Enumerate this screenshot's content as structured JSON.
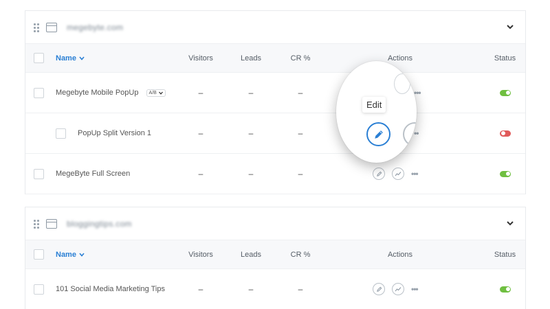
{
  "columns": {
    "name": "Name",
    "visitors": "Visitors",
    "leads": "Leads",
    "cr": "CR %",
    "actions": "Actions",
    "status": "Status"
  },
  "sites": [
    {
      "name": "megebyte.com",
      "rows": [
        {
          "name": "Megebyte Mobile PopUp",
          "badge": "A/B",
          "visitors": "–",
          "leads": "–",
          "cr": "–",
          "status": "on"
        },
        {
          "name": "PopUp Split Version 1",
          "visitors": "–",
          "leads": "–",
          "cr": "–",
          "status": "off"
        },
        {
          "name": "MegeByte Full Screen",
          "visitors": "–",
          "leads": "–",
          "cr": "–",
          "status": "on"
        }
      ]
    },
    {
      "name": "bloggingtips.com",
      "rows": [
        {
          "name": "101 Social Media Marketing Tips",
          "visitors": "–",
          "leads": "–",
          "cr": "–",
          "status": "on"
        }
      ]
    }
  ],
  "tooltip": "Edit",
  "icons": {
    "drag": "drag-handle-icon",
    "browser": "browser-window-icon",
    "collapse": "chevron-down-icon",
    "edit": "pencil-icon",
    "stats": "trend-chart-icon",
    "more": "more-dots-icon"
  },
  "colors": {
    "accent": "#2a7fd4",
    "status_on": "#6fbf40",
    "status_off": "#e05a5a"
  }
}
